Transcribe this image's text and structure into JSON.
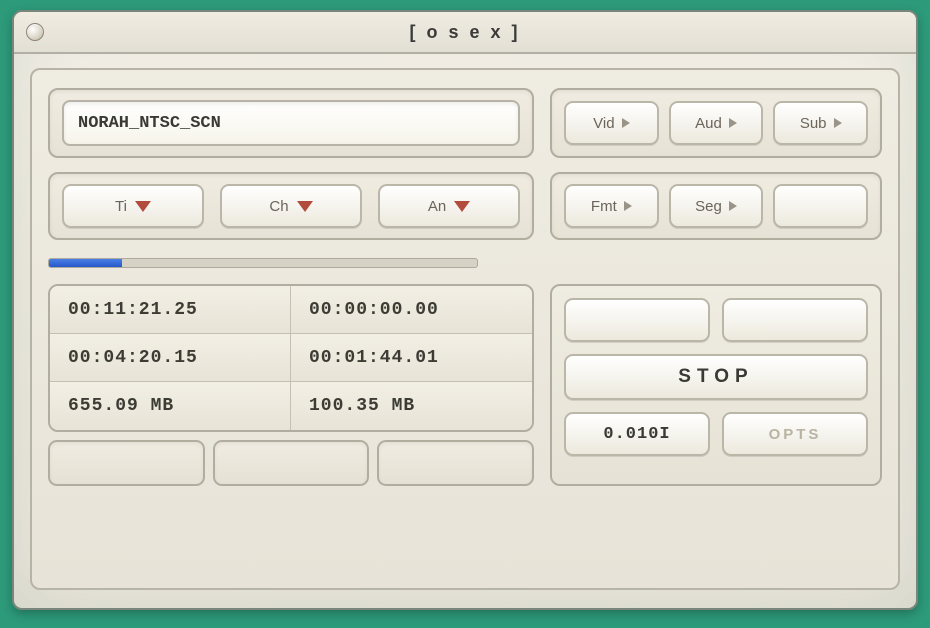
{
  "window": {
    "title": "[ o s e x ]"
  },
  "disc": {
    "name": "NORAH_NTSC_SCN"
  },
  "streams": {
    "video": "Vid",
    "audio": "Aud",
    "subtitle": "Sub"
  },
  "selectors": {
    "title": "Ti",
    "chapter": "Ch",
    "angle": "An"
  },
  "format": {
    "fmt": "Fmt",
    "seg": "Seg",
    "blank": ""
  },
  "progress": {
    "percent": 17
  },
  "stats": {
    "total_time": "00:11:21.25",
    "null_time": "00:00:00.00",
    "done_time": "00:04:20.15",
    "elapsed": "00:01:44.01",
    "total_size": "655.09 MB",
    "done_size": "100.35 MB"
  },
  "controls": {
    "stop": "STOP",
    "rate": "0.010I",
    "opts": "OPTS"
  }
}
